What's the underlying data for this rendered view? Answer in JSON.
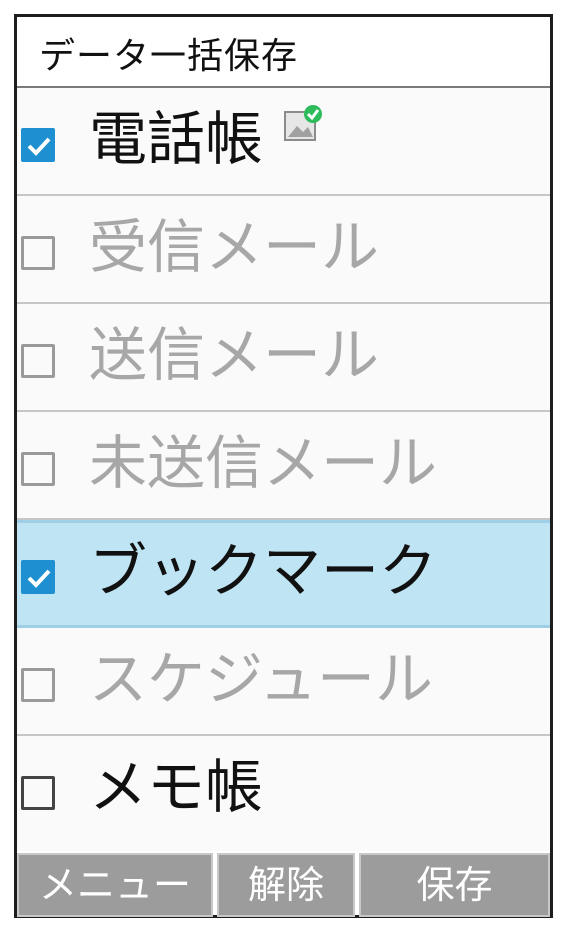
{
  "header": {
    "title": "データ一括保存"
  },
  "items": [
    {
      "label": "電話帳",
      "checked": true,
      "enabled": true
    },
    {
      "label": "受信メール",
      "checked": false,
      "enabled": false
    },
    {
      "label": "送信メール",
      "checked": false,
      "enabled": false
    },
    {
      "label": "未送信メール",
      "checked": false,
      "enabled": false
    },
    {
      "label": "ブックマーク",
      "checked": true,
      "enabled": true,
      "focused": true
    },
    {
      "label": "スケジュール",
      "checked": false,
      "enabled": false
    },
    {
      "label": "メモ帳",
      "checked": false,
      "enabled": true
    }
  ],
  "softkeys": {
    "left": "メニュー",
    "center": "解除",
    "right": "保存"
  },
  "colors": {
    "focus_bg": "#bfe4f4",
    "check_blue": "#1e8fd0",
    "softkey_bg": "#9c9c9c",
    "badge_green": "#2dbb5c"
  },
  "icons": {
    "sync_badge": "image-with-green-check-icon"
  }
}
